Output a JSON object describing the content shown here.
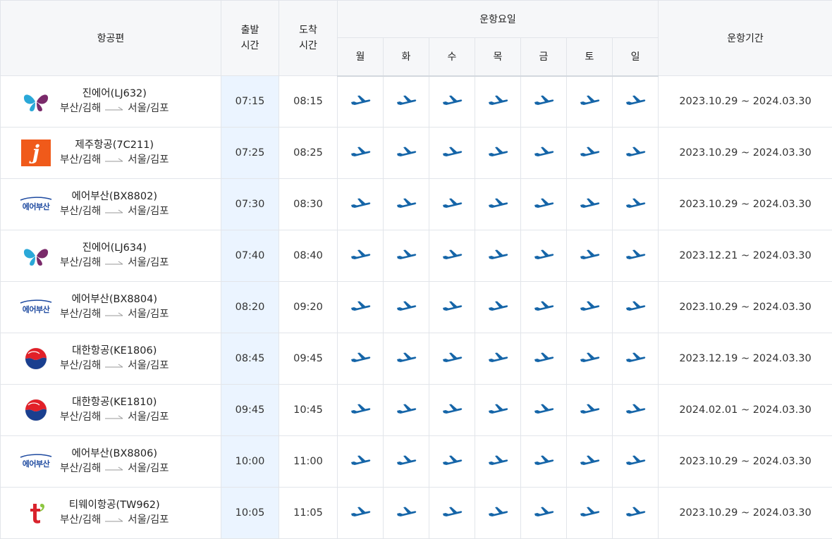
{
  "header": {
    "flight": "항공편",
    "dep_time": [
      "출발",
      "시간"
    ],
    "arr_time": [
      "도착",
      "시간"
    ],
    "op_days": "운항요일",
    "days": [
      "월",
      "화",
      "수",
      "목",
      "금",
      "토",
      "일"
    ],
    "period": "운항기간"
  },
  "icons": {
    "plane": "airplane-icon",
    "plane_color": "#1565a8",
    "route_arrow": "long-arrow-icon"
  },
  "rows": [
    {
      "airline": "jinair",
      "name": "진에어(LJ632)",
      "from": "부산/김해",
      "to": "서울/김포",
      "dep": "07:15",
      "arr": "08:15",
      "period": "2023.10.29 ~ 2024.03.30"
    },
    {
      "airline": "jejuair",
      "name": "제주항공(7C211)",
      "from": "부산/김해",
      "to": "서울/김포",
      "dep": "07:25",
      "arr": "08:25",
      "period": "2023.10.29 ~ 2024.03.30"
    },
    {
      "airline": "airbusan",
      "name": "에어부산(BX8802)",
      "from": "부산/김해",
      "to": "서울/김포",
      "dep": "07:30",
      "arr": "08:30",
      "period": "2023.10.29 ~ 2024.03.30"
    },
    {
      "airline": "jinair",
      "name": "진에어(LJ634)",
      "from": "부산/김해",
      "to": "서울/김포",
      "dep": "07:40",
      "arr": "08:40",
      "period": "2023.12.21 ~ 2024.03.30"
    },
    {
      "airline": "airbusan",
      "name": "에어부산(BX8804)",
      "from": "부산/김해",
      "to": "서울/김포",
      "dep": "08:20",
      "arr": "09:20",
      "period": "2023.10.29 ~ 2024.03.30"
    },
    {
      "airline": "koreanair",
      "name": "대한항공(KE1806)",
      "from": "부산/김해",
      "to": "서울/김포",
      "dep": "08:45",
      "arr": "09:45",
      "period": "2023.12.19 ~ 2024.03.30"
    },
    {
      "airline": "koreanair",
      "name": "대한항공(KE1810)",
      "from": "부산/김해",
      "to": "서울/김포",
      "dep": "09:45",
      "arr": "10:45",
      "period": "2024.02.01 ~ 2024.03.30"
    },
    {
      "airline": "airbusan",
      "name": "에어부산(BX8806)",
      "from": "부산/김해",
      "to": "서울/김포",
      "dep": "10:00",
      "arr": "11:00",
      "period": "2023.10.29 ~ 2024.03.30"
    },
    {
      "airline": "tway",
      "name": "티웨이항공(TW962)",
      "from": "부산/김해",
      "to": "서울/김포",
      "dep": "10:05",
      "arr": "11:05",
      "period": "2023.10.29 ~ 2024.03.30"
    }
  ],
  "logo_text": {
    "jejuair": "j",
    "airbusan": "에어부산",
    "tway": "t"
  }
}
